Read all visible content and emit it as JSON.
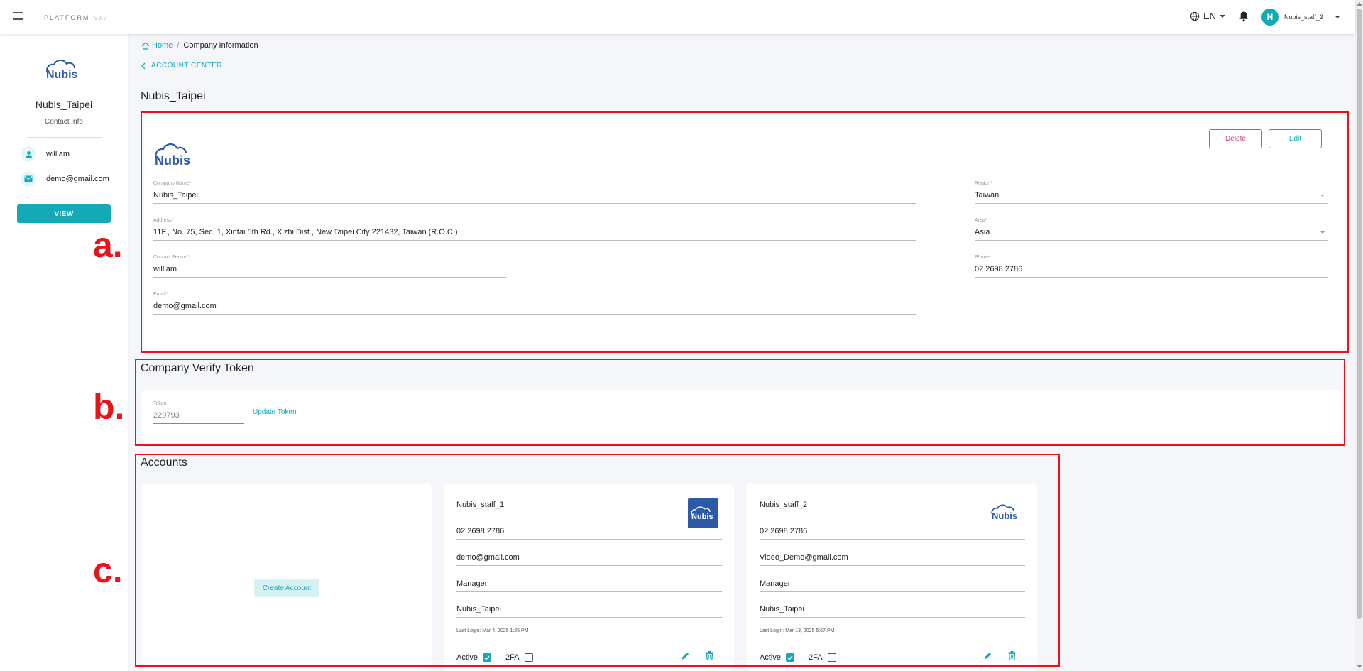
{
  "topbar": {
    "brand": "PLATFORM",
    "version": "V3.7",
    "language": "EN",
    "avatar_initial": "N",
    "user_name": "Nubis_staff_2"
  },
  "sidebar": {
    "logo_text": "Nubis",
    "company_name": "Nubis_Taipei",
    "contact_info_label": "Contact Info",
    "contact_person": "william",
    "email": "demo@gmail.com",
    "view_label": "VIEW"
  },
  "breadcrumb": {
    "home": "Home",
    "current": "Company Information"
  },
  "back_link": "ACCOUNT CENTER",
  "page_title": "Nubis_Taipei",
  "company": {
    "logo_text": "Nubis",
    "delete_label": "Delete",
    "edit_label": "Edit",
    "fields": {
      "company_name": {
        "label": "Company Name*",
        "value": "Nubis_Taipei"
      },
      "region": {
        "label": "Region*",
        "value": "Taiwan"
      },
      "address": {
        "label": "Address*",
        "value": "11F., No. 75, Sec. 1, Xintai 5th Rd., Xizhi Dist., New Taipei City 221432, Taiwan (R.O.C.)"
      },
      "area": {
        "label": "Area*",
        "value": "Asia"
      },
      "contact_person": {
        "label": "Contact Person*",
        "value": "william"
      },
      "phone": {
        "label": "Phone*",
        "value": "02 2698 2786"
      },
      "email": {
        "label": "Email*",
        "value": "demo@gmail.com"
      }
    }
  },
  "token_section": {
    "title": "Company Verify Token",
    "label": "Token",
    "value": "229793",
    "update_label": "Update Token"
  },
  "accounts_section": {
    "title": "Accounts",
    "create_label": "Create Account",
    "active_label": "Active",
    "twofa_label": "2FA",
    "accounts": [
      {
        "username": "Nubis_staff_1",
        "phone": "02 2698 2786",
        "email": "demo@gmail.com",
        "role": "Manager",
        "company": "Nubis_Taipei",
        "last_login": "Last Login: Mar 4, 2025 1:25 PM",
        "logo_text": "Nubis",
        "active": true,
        "twofa": false
      },
      {
        "username": "Nubis_staff_2",
        "phone": "02 2698 2786",
        "email": "Video_Demo@gmail.com",
        "role": "Manager",
        "company": "Nubis_Taipei",
        "last_login": "Last Login: Mar 13, 2025 5:57 PM",
        "logo_text": "Nubis",
        "active": true,
        "twofa": false
      }
    ]
  },
  "callouts": {
    "a": "a.",
    "b": "b.",
    "c": "c."
  },
  "colors": {
    "accent": "#13a9b7",
    "danger": "#e03a6f",
    "annotation": "#e8141c",
    "brand_blue": "#2d5aa8"
  }
}
